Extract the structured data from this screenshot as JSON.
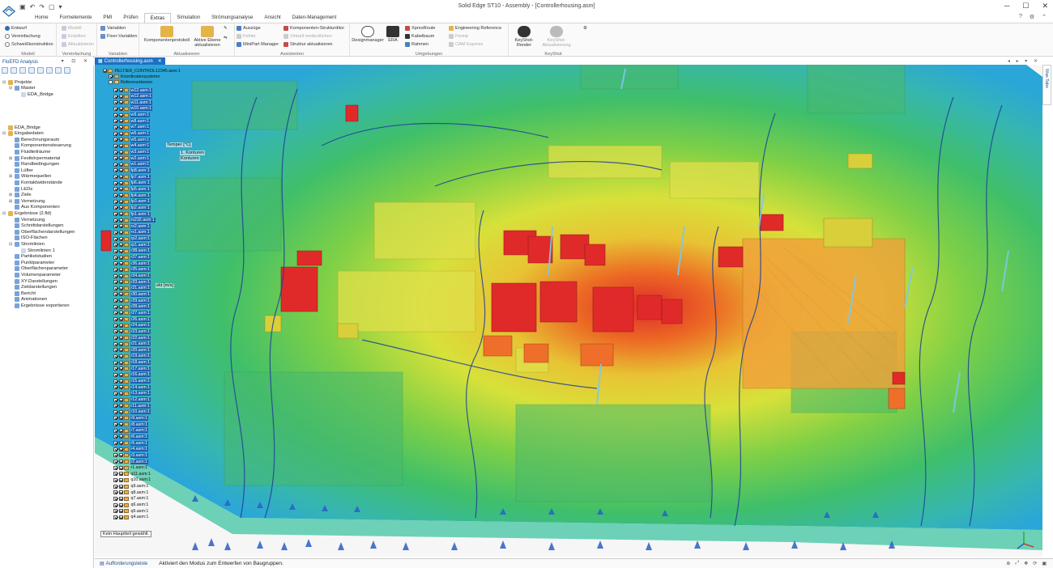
{
  "window": {
    "title": "Solid Edge ST10 - Assembly - [Controllerhousing.asm]"
  },
  "ribbon": {
    "tabs": [
      "Home",
      "Formelemente",
      "PMI",
      "Prüfen",
      "Extras",
      "Simulation",
      "Strömungsanalyse",
      "Ansicht",
      "Daten-Management"
    ],
    "active_tab": "Extras",
    "groups": {
      "modell": {
        "name": "Modell",
        "items": [
          "Entwurf",
          "Vereinfachung",
          "Schweißkonstruktion"
        ]
      },
      "vereinfachung": {
        "name": "Vereinfachung",
        "items": [
          "Modell",
          "Erstellen",
          "Aktualisieren"
        ]
      },
      "variablen": {
        "name": "Variablen",
        "items": [
          "Variablen",
          "Fixer-Variablen"
        ]
      },
      "aktualisieren": {
        "name": "Aktualisieren",
        "big": [
          "Komponentenprotokoll",
          "Aktive Ebene aktualisieren"
        ]
      },
      "assistenten": {
        "name": "Assistenten",
        "items": [
          "Auszüge",
          "Fehler",
          "MiniPart Manager",
          "Komponenten-Strukturditor",
          "Virtuell verdeutlichen",
          "Struktur aktualisieren"
        ]
      },
      "umgebungen": {
        "name": "Umgebungen",
        "big": [
          "Designmanager",
          "ERA"
        ],
        "items": [
          "XpresRoute",
          "Kabelbaum",
          "Rahmen",
          "Engineering Reference",
          "Formp",
          "CAM Express"
        ]
      },
      "keyshot": {
        "name": "KeyShot",
        "big": [
          "KeyShot-Render",
          "KeyShot-Aktualisierung"
        ]
      }
    }
  },
  "left_panel": {
    "title": "FloEFD Analysis",
    "projects_tree": [
      {
        "label": "Projekte",
        "level": 0,
        "expand": "-"
      },
      {
        "label": "Master",
        "level": 1,
        "expand": "-"
      },
      {
        "label": "EDA_Bridge",
        "level": 2,
        "expand": ""
      }
    ],
    "analysis_tree": [
      {
        "label": "EDA_Bridge",
        "level": 0,
        "expand": ""
      },
      {
        "label": "Eingabedaten",
        "level": 0,
        "expand": "-"
      },
      {
        "label": "Berechnungsraum",
        "level": 1,
        "expand": ""
      },
      {
        "label": "Komponentensteuerung",
        "level": 1,
        "expand": ""
      },
      {
        "label": "Fluidteilräume",
        "level": 1,
        "expand": ""
      },
      {
        "label": "Festkörpermaterial",
        "level": 1,
        "expand": "+"
      },
      {
        "label": "Randbedingungen",
        "level": 1,
        "expand": ""
      },
      {
        "label": "Lüfter",
        "level": 1,
        "expand": ""
      },
      {
        "label": "Wärmequellen",
        "level": 1,
        "expand": "+"
      },
      {
        "label": "Kontaktwiderstände",
        "level": 1,
        "expand": ""
      },
      {
        "label": "LEDs",
        "level": 1,
        "expand": ""
      },
      {
        "label": "Ziele",
        "level": 1,
        "expand": "+"
      },
      {
        "label": "Vernetzung",
        "level": 1,
        "expand": "+"
      },
      {
        "label": "Aus Komponenten",
        "level": 1,
        "expand": ""
      },
      {
        "label": "Ergebnisse (2.fld)",
        "level": 0,
        "expand": "-"
      },
      {
        "label": "Vernetzung",
        "level": 1,
        "expand": ""
      },
      {
        "label": "Schnittdarstellungen",
        "level": 1,
        "expand": ""
      },
      {
        "label": "Oberflächendarstellungen",
        "level": 1,
        "expand": ""
      },
      {
        "label": "ISO-Flächen",
        "level": 1,
        "expand": ""
      },
      {
        "label": "Stromlinien",
        "level": 1,
        "expand": "-"
      },
      {
        "label": "Stromlinien 1",
        "level": 2,
        "expand": ""
      },
      {
        "label": "Partikelstudien",
        "level": 1,
        "expand": ""
      },
      {
        "label": "Punktparameter",
        "level": 1,
        "expand": ""
      },
      {
        "label": "Oberflächenparameter",
        "level": 1,
        "expand": ""
      },
      {
        "label": "Volumenparameter",
        "level": 1,
        "expand": ""
      },
      {
        "label": "XY-Darstellungen",
        "level": 1,
        "expand": ""
      },
      {
        "label": "Zieldarstellungen",
        "level": 1,
        "expand": ""
      },
      {
        "label": "Bericht",
        "level": 1,
        "expand": ""
      },
      {
        "label": "Animationen",
        "level": 1,
        "expand": ""
      },
      {
        "label": "Ergebnisse exportieren",
        "level": 1,
        "expand": ""
      }
    ]
  },
  "document_tab": {
    "label": "Controllerhousing.asm"
  },
  "pathfinder": {
    "root": "PELTIER_CONTROL12345.asm:1",
    "sub1": "Koordinatensysteme",
    "sub2": "Referenzebenen",
    "parts": [
      "w12.asm:1",
      "w12.asm:1",
      "w11.asm:1",
      "w10.asm:1",
      "w9.asm:1",
      "w8.asm:1",
      "w7.asm:1",
      "w6.asm:1",
      "w5.asm:1",
      "w4.asm:1",
      "w3.asm:1",
      "w2.asm:1",
      "w1.asm:1",
      "fp8.asm:1",
      "fp7.asm:1",
      "fp6.asm:1",
      "fp5.asm:1",
      "fp4.asm:1",
      "fp3.asm:1",
      "fp2.asm:1",
      "fp1.asm:1",
      "rs232.asm:1",
      "rx2.asm:1",
      "rx1.asm:1",
      "rp2.asm:1",
      "rp1.asm:1",
      "r38.asm:1",
      "r37.asm:1",
      "r36.asm:1",
      "r35.asm:1",
      "r34.asm:1",
      "r33.asm:1",
      "r31.asm:1",
      "r30.asm:1",
      "r29.asm:1",
      "r28.asm:1",
      "r27.asm:1",
      "r26.asm:1",
      "r24.asm:1",
      "r23.asm:1",
      "r22.asm:1",
      "r21.asm:1",
      "r20.asm:1",
      "r19.asm:1",
      "r18.asm:1",
      "r17.asm:1",
      "r16.asm:1",
      "r15.asm:1",
      "r14.asm:1",
      "r13.asm:1",
      "r12.asm:1",
      "r11.asm:1",
      "r10.asm:1",
      "r9.asm:1",
      "r8.asm:1",
      "r7.asm:1",
      "r6.asm:1",
      "r5.asm:1",
      "r4.asm:1",
      "r3.asm:1",
      "r2.asm:1",
      "r1.asm:1",
      "q11.asm:1",
      "q10.asm:1",
      "q9.asm:1",
      "q8.asm:1",
      "q7.asm:1",
      "q6.asm:1",
      "q5.asm:1",
      "q4.asm:1"
    ],
    "selected_count": 61,
    "status_message": "Kein Hauptteil gewählt."
  },
  "viewport_overlays": {
    "legend_label": "Geschw. [m/s]",
    "legend_label_b": "ekt [m/s]",
    "cut_plot": "Temper [°C]",
    "cut_items": [
      "1. Konturen",
      "Konturen"
    ]
  },
  "statusbar": {
    "command_bar": "Aufforderungsleiste",
    "hint": "Aktiviert den Modus zum Entwerfen von Baugruppen."
  },
  "side_tab": {
    "label": "Was Tabs"
  },
  "colors": {
    "accent": "#1c6fc2",
    "selection": "#1c5fb0",
    "hot": "#e02a2a",
    "warm": "#e8dc3a",
    "cool": "#3fbf6a",
    "cold": "#2aa6d9",
    "board": "#55c8a0"
  }
}
